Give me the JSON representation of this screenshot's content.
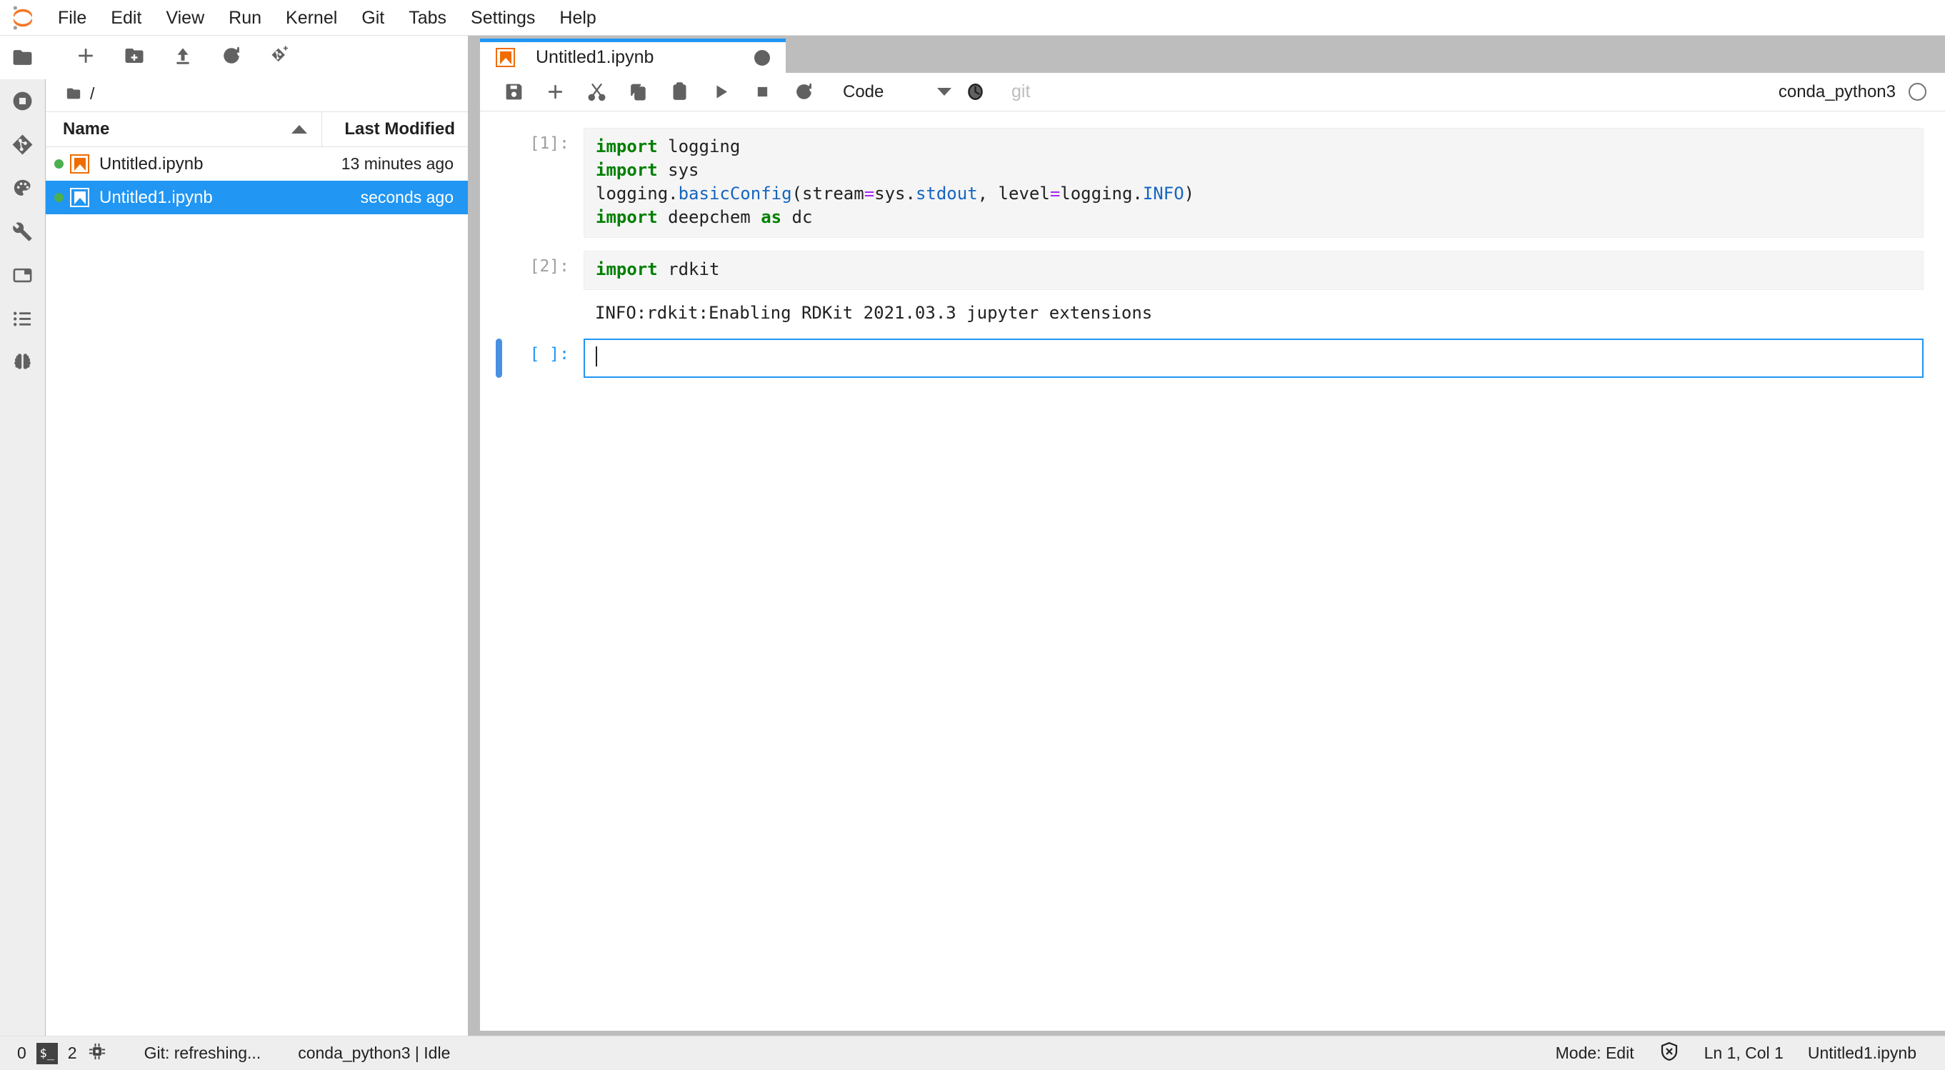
{
  "menubar": {
    "logo": "jupyter-logo",
    "items": [
      {
        "label": "File"
      },
      {
        "label": "Edit"
      },
      {
        "label": "View"
      },
      {
        "label": "Run"
      },
      {
        "label": "Kernel"
      },
      {
        "label": "Git"
      },
      {
        "label": "Tabs"
      },
      {
        "label": "Settings"
      },
      {
        "label": "Help"
      }
    ]
  },
  "rail": {
    "items": [
      {
        "icon": "folder-icon",
        "name": "file-browser",
        "active": true
      },
      {
        "icon": "running-terminals-icon",
        "name": "running-sessions",
        "active": false
      },
      {
        "icon": "git-icon",
        "name": "git-panel",
        "active": false
      },
      {
        "icon": "palette-icon",
        "name": "extension-manager",
        "active": false
      },
      {
        "icon": "wrench-icon",
        "name": "property-inspector",
        "active": false
      },
      {
        "icon": "open-tabs-icon",
        "name": "open-tabs",
        "active": false
      },
      {
        "icon": "list-icon",
        "name": "table-of-contents",
        "active": false
      },
      {
        "icon": "brain-icon",
        "name": "ai-extension",
        "active": false
      }
    ]
  },
  "filebrowser": {
    "toolbar": [
      {
        "icon": "plus-icon",
        "name": "new-launcher-button",
        "title": "New Launcher"
      },
      {
        "icon": "new-folder-icon",
        "name": "new-folder-button",
        "title": "New Folder"
      },
      {
        "icon": "upload-icon",
        "name": "upload-files-button",
        "title": "Upload Files"
      },
      {
        "icon": "refresh-icon",
        "name": "refresh-file-list-button",
        "title": "Refresh File List"
      },
      {
        "icon": "git-clone-icon",
        "name": "git-clone-button",
        "title": "Git Clone"
      }
    ],
    "breadcrumb": "/",
    "columns": {
      "name": "Name",
      "modified": "Last Modified"
    },
    "sort": "ascending",
    "files": [
      {
        "name": "Untitled.ipynb",
        "modified": "13 minutes ago",
        "running": true,
        "selected": false
      },
      {
        "name": "Untitled1.ipynb",
        "modified": "seconds ago",
        "running": true,
        "selected": true
      }
    ]
  },
  "dock": {
    "tabs": [
      {
        "label": "Untitled1.ipynb",
        "dirty": true,
        "active": true
      }
    ]
  },
  "notebook": {
    "toolbar": [
      {
        "icon": "save-icon",
        "name": "save-notebook-button",
        "title": "Save"
      },
      {
        "icon": "plus-icon",
        "name": "insert-cell-button",
        "title": "Insert a cell below"
      },
      {
        "icon": "cut-icon",
        "name": "cut-cell-button",
        "title": "Cut selected cells"
      },
      {
        "icon": "copy-icon",
        "name": "copy-cell-button",
        "title": "Copy selected cells"
      },
      {
        "icon": "paste-icon",
        "name": "paste-cell-button",
        "title": "Paste cells below"
      },
      {
        "icon": "run-icon",
        "name": "run-cell-button",
        "title": "Run selected cells"
      },
      {
        "icon": "stop-icon",
        "name": "interrupt-kernel-button",
        "title": "Interrupt the kernel"
      },
      {
        "icon": "restart-icon",
        "name": "restart-kernel-button",
        "title": "Restart the kernel"
      }
    ],
    "cell_type": "Code",
    "history_icon": "clock-icon",
    "git_label": "git",
    "kernel_name": "conda_python3",
    "kernel_status": "idle",
    "cells": [
      {
        "prompt": "[1]:",
        "active": false,
        "lines": [
          [
            {
              "t": "import",
              "c": "kw"
            },
            {
              "t": " logging",
              "c": ""
            }
          ],
          [
            {
              "t": "import",
              "c": "kw"
            },
            {
              "t": " sys",
              "c": ""
            }
          ],
          [
            {
              "t": "logging.",
              "c": ""
            },
            {
              "t": "basicConfig",
              "c": "fn"
            },
            {
              "t": "(stream",
              "c": ""
            },
            {
              "t": "=",
              "c": "op"
            },
            {
              "t": "sys.",
              "c": ""
            },
            {
              "t": "stdout",
              "c": "fn"
            },
            {
              "t": ", level",
              "c": ""
            },
            {
              "t": "=",
              "c": "op"
            },
            {
              "t": "logging.",
              "c": ""
            },
            {
              "t": "INFO",
              "c": "fn"
            },
            {
              "t": ")",
              "c": ""
            }
          ],
          [
            {
              "t": "import",
              "c": "kw"
            },
            {
              "t": " deepchem ",
              "c": ""
            },
            {
              "t": "as",
              "c": "kw"
            },
            {
              "t": " dc",
              "c": ""
            }
          ]
        ],
        "output": null
      },
      {
        "prompt": "[2]:",
        "active": false,
        "lines": [
          [
            {
              "t": "import",
              "c": "kw"
            },
            {
              "t": " rdkit",
              "c": ""
            }
          ]
        ],
        "output": "INFO:rdkit:Enabling RDKit 2021.03.3 jupyter extensions"
      },
      {
        "prompt": "[ ]:",
        "active": true,
        "lines": [],
        "output": null
      }
    ]
  },
  "statusbar": {
    "terminals_count": "0",
    "terminal_icon": "$_",
    "kernels_count": "2",
    "kernel_icon": "cpu-chip-icon",
    "git_status": "Git: refreshing...",
    "kernel_status": "conda_python3 | Idle",
    "mode": "Mode: Edit",
    "trust_icon": "untrusted-shield-icon",
    "cursor_position": "Ln 1, Col 1",
    "filename": "Untitled1.ipynb"
  },
  "colors": {
    "accent": "#2196f3",
    "selection": "#2196f3",
    "notebook_orange": "#ef6c00",
    "running_green": "#4caf50",
    "keyword_green": "#008000",
    "function_blue": "#1565c0",
    "operator_purple": "#aa22ff"
  }
}
